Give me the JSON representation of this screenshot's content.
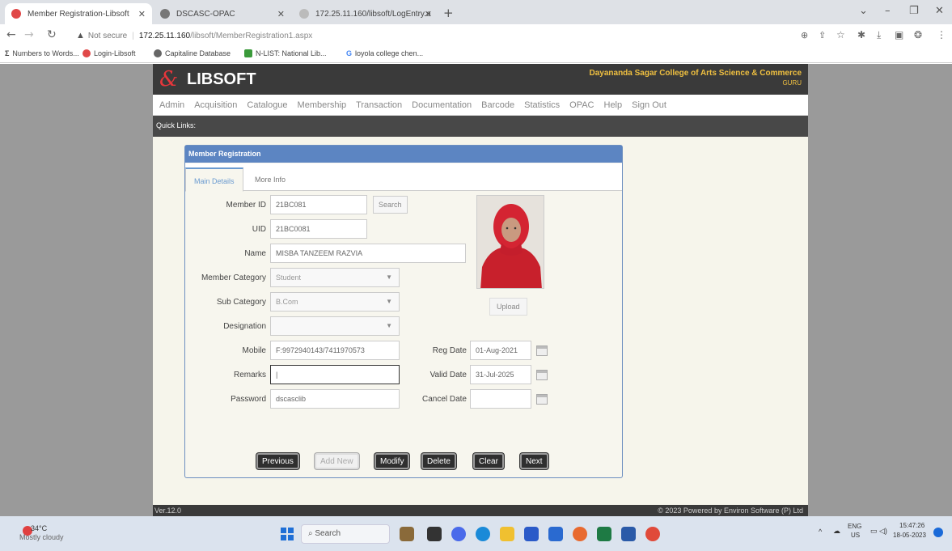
{
  "browser": {
    "tabs": [
      {
        "title": "Member Registration-Libsoft"
      },
      {
        "title": "DSCASC-OPAC"
      },
      {
        "title": "172.25.11.160/libsoft/LogEntry.a"
      }
    ],
    "url_warning": "Not secure",
    "url_domain": "172.25.11.160",
    "url_path": "/libsoft/MemberRegistration1.aspx",
    "bookmarks": [
      "Numbers to Words...",
      "Login-Libsoft",
      "Capitaline Database",
      "N-LIST: National Lib...",
      "loyola college chen..."
    ]
  },
  "app": {
    "logo_text": "LIBSOFT",
    "college_name": "Dayananda Sagar College of Arts Science & Commerce",
    "user": "GURU",
    "menu": [
      "Admin",
      "Acquisition",
      "Catalogue",
      "Membership",
      "Transaction",
      "Documentation",
      "Barcode",
      "Statistics",
      "OPAC",
      "Help",
      "Sign Out"
    ],
    "quick_links": "Quick Links:",
    "version": "Ver.12.0",
    "copyright": "© 2023  Powered by Environ Software (P) Ltd"
  },
  "form": {
    "title": "Member Registration",
    "tabs": [
      "Main Details",
      "More Info"
    ],
    "labels": {
      "member_id": "Member ID",
      "uid": "UID",
      "name": "Name",
      "member_category": "Member Category",
      "sub_category": "Sub Category",
      "designation": "Designation",
      "mobile": "Mobile",
      "remarks": "Remarks",
      "password": "Password",
      "reg_date": "Reg Date",
      "valid_date": "Valid Date",
      "cancel_date": "Cancel Date"
    },
    "values": {
      "member_id": "21BC081",
      "uid": "21BC0081",
      "name": "MISBA TANZEEM RAZVIA",
      "member_category": "Student",
      "sub_category": "B.Com",
      "designation": "",
      "mobile": "F:9972940143/7411970573",
      "remarks": "|",
      "password": "dscasclib",
      "reg_date": "01-Aug-2021",
      "valid_date": "31-Jul-2025",
      "cancel_date": ""
    },
    "search_button": "Search",
    "upload_button": "Upload",
    "actions": [
      "Previous",
      "Add New",
      "Modify",
      "Delete",
      "Clear",
      "Next"
    ]
  },
  "taskbar": {
    "temperature": "34°C",
    "weather": "Mostly cloudy",
    "search_placeholder": "Search",
    "lang_top": "ENG",
    "lang_bottom": "US",
    "time": "15:47:26",
    "date": "18-05-2023"
  }
}
